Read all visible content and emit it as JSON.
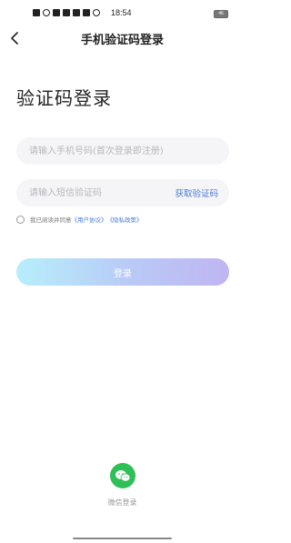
{
  "status_bar": {
    "time": "18:54",
    "battery": "46"
  },
  "nav": {
    "title": "手机验证码登录"
  },
  "main": {
    "heading": "验证码登录",
    "phone_placeholder": "请输入手机号码(首次登录即注册)",
    "code_placeholder": "请输入短信验证码",
    "get_code_label": "获取验证码",
    "agree_prefix": "我已阅读并同意",
    "user_agreement": "《用户协议》",
    "privacy_policy": "《隐私政策》",
    "login_label": "登录",
    "wechat_login_label": "微信登录"
  },
  "colors": {
    "accent": "#4a7bd8",
    "wechat_green": "#2fbf57",
    "login_gradient_start": "#b7eefb",
    "login_gradient_end": "#bfb5f2"
  },
  "icons": {
    "back": "chevron-left-icon",
    "wechat": "wechat-icon"
  }
}
